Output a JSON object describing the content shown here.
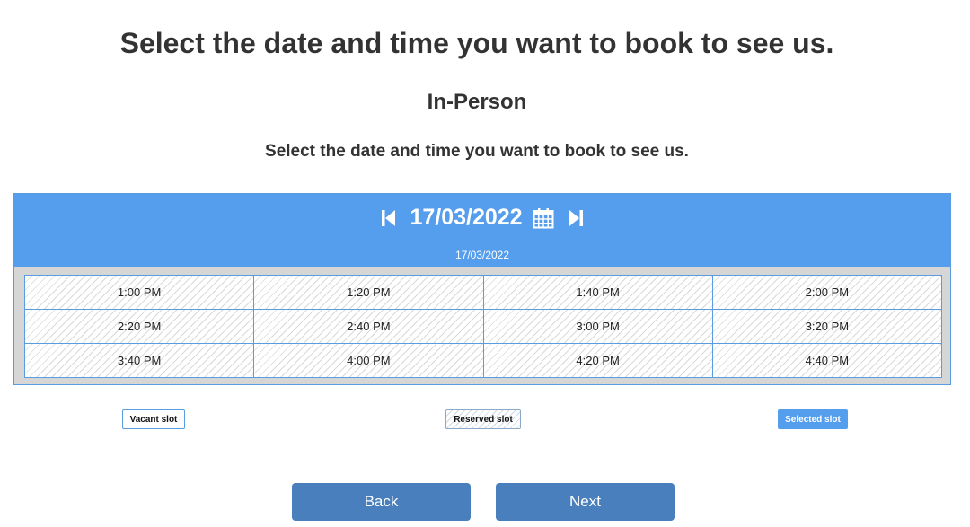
{
  "header": {
    "title": "Select the date and time you want to book to see us.",
    "appointment_type": "In-Person",
    "instruction": "Select the date and time you want to book to see us."
  },
  "calendar": {
    "selected_date": "17/03/2022",
    "date_bar": "17/03/2022",
    "prev_icon": "skip-previous-icon",
    "next_icon": "skip-next-icon",
    "calendar_icon": "calendar-icon",
    "slots": [
      {
        "time": "1:00 PM",
        "state": "reserved"
      },
      {
        "time": "1:20 PM",
        "state": "reserved"
      },
      {
        "time": "1:40 PM",
        "state": "reserved"
      },
      {
        "time": "2:00 PM",
        "state": "reserved"
      },
      {
        "time": "2:20 PM",
        "state": "reserved"
      },
      {
        "time": "2:40 PM",
        "state": "reserved"
      },
      {
        "time": "3:00 PM",
        "state": "reserved"
      },
      {
        "time": "3:20 PM",
        "state": "reserved"
      },
      {
        "time": "3:40 PM",
        "state": "reserved"
      },
      {
        "time": "4:00 PM",
        "state": "reserved"
      },
      {
        "time": "4:20 PM",
        "state": "reserved"
      },
      {
        "time": "4:40 PM",
        "state": "reserved"
      }
    ]
  },
  "legend": {
    "vacant": "Vacant slot",
    "reserved": "Reserved slot",
    "selected": "Selected slot"
  },
  "actions": {
    "back": "Back",
    "next": "Next"
  },
  "colors": {
    "accent": "#559ded",
    "button": "#4a7fbd",
    "text": "#333333"
  }
}
